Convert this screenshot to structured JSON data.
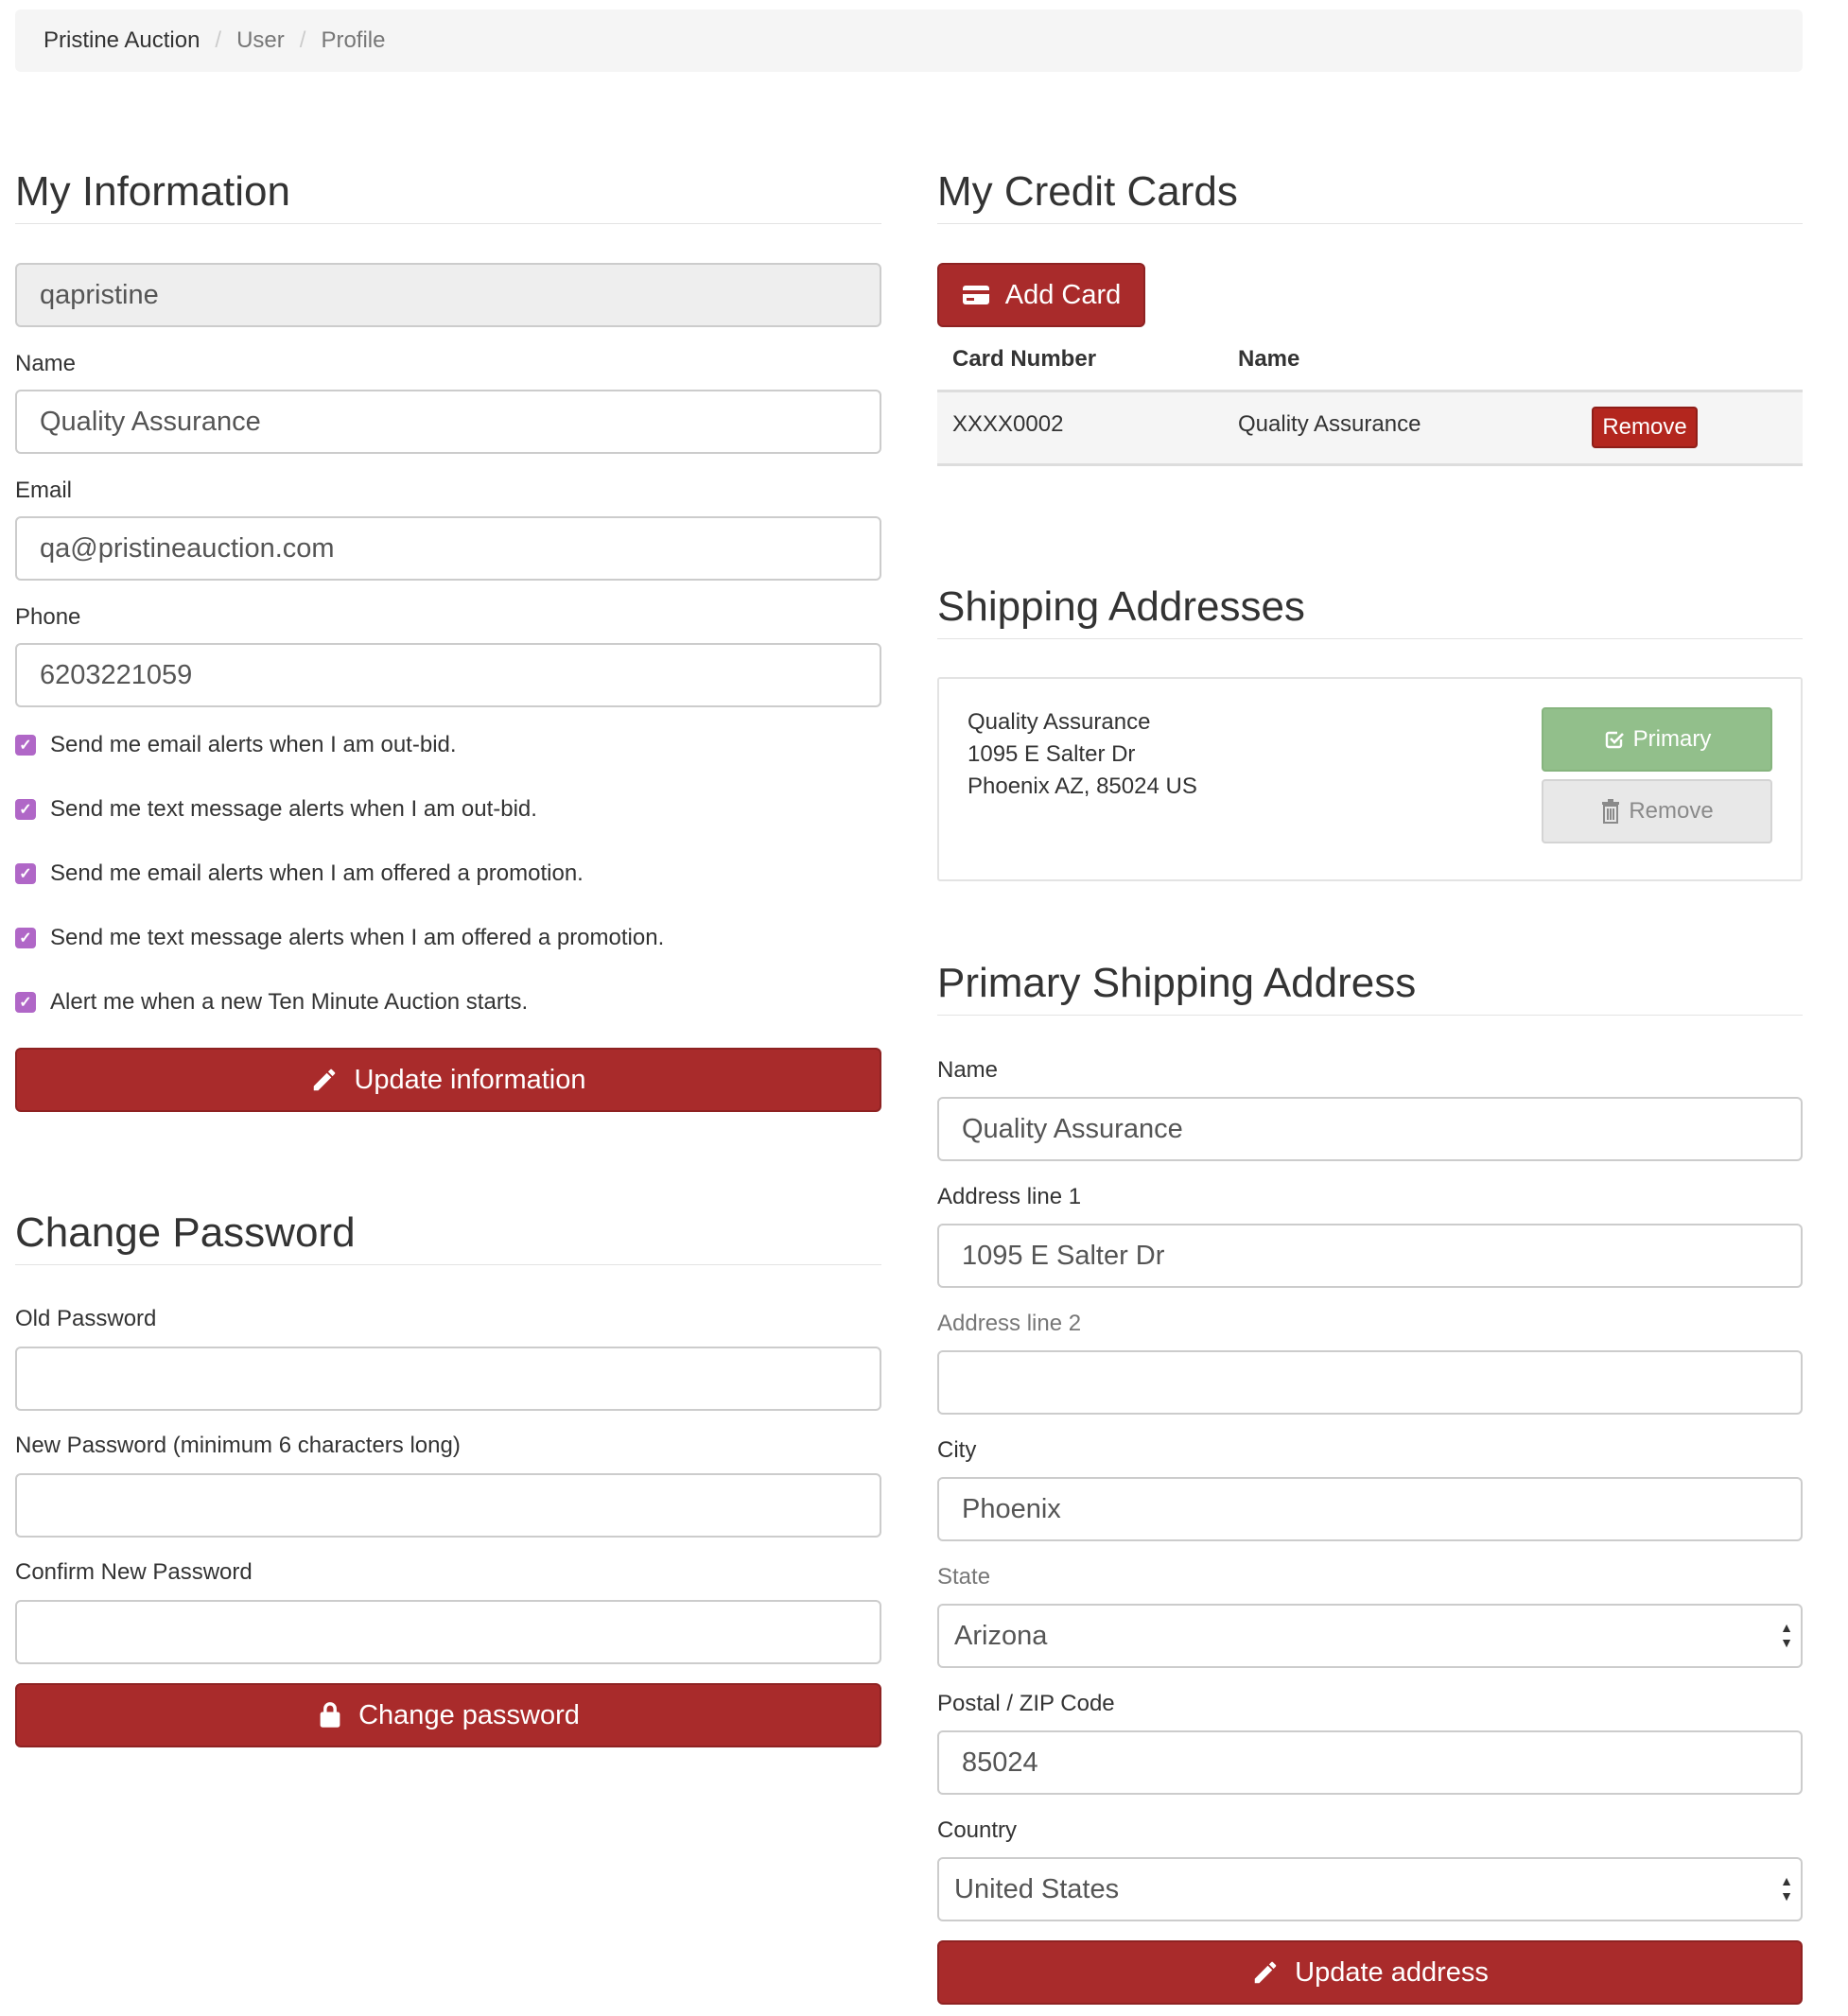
{
  "breadcrumb": {
    "items": [
      "Pristine Auction",
      "User",
      "Profile"
    ],
    "separator": "/"
  },
  "my_information": {
    "title": "My Information",
    "username": "qapristine",
    "name_label": "Name",
    "name_value": "Quality Assurance",
    "email_label": "Email",
    "email_value": "qa@pristineauction.com",
    "phone_label": "Phone",
    "phone_value": "6203221059",
    "checkboxes": [
      {
        "label": "Send me email alerts when I am out-bid.",
        "checked": true
      },
      {
        "label": "Send me text message alerts when I am out-bid.",
        "checked": true
      },
      {
        "label": "Send me email alerts when I am offered a promotion.",
        "checked": true
      },
      {
        "label": "Send me text message alerts when I am offered a promotion.",
        "checked": true
      },
      {
        "label": "Alert me when a new Ten Minute Auction starts.",
        "checked": true
      }
    ],
    "update_button": "Update information"
  },
  "change_password": {
    "title": "Change Password",
    "old_label": "Old Password",
    "new_label": "New Password (minimum 6 characters long)",
    "confirm_label": "Confirm New Password",
    "button": "Change password"
  },
  "credit_cards": {
    "title": "My Credit Cards",
    "add_button": "Add Card",
    "headers": [
      "Card Number",
      "Name"
    ],
    "rows": [
      {
        "number": "XXXX0002",
        "name": "Quality Assurance",
        "action": "Remove"
      }
    ]
  },
  "shipping_addresses": {
    "title": "Shipping Addresses",
    "address_lines": [
      "Quality Assurance",
      "1095 E Salter Dr",
      "Phoenix AZ, 85024 US"
    ],
    "primary_button": "Primary",
    "remove_button": "Remove"
  },
  "primary_shipping": {
    "title": "Primary Shipping Address",
    "name_label": "Name",
    "name_value": "Quality Assurance",
    "address1_label": "Address line 1",
    "address1_value": "1095 E Salter Dr",
    "address2_label": "Address line 2",
    "address2_value": "",
    "city_label": "City",
    "city_value": "Phoenix",
    "state_label": "State",
    "state_value": "Arizona",
    "zip_label": "Postal / ZIP Code",
    "zip_value": "85024",
    "country_label": "Country",
    "country_value": "United States",
    "button": "Update address"
  },
  "colors": {
    "brand_red": "#a92b2b",
    "checkbox_purple": "#b067c7",
    "primary_green": "#92bf8b"
  }
}
